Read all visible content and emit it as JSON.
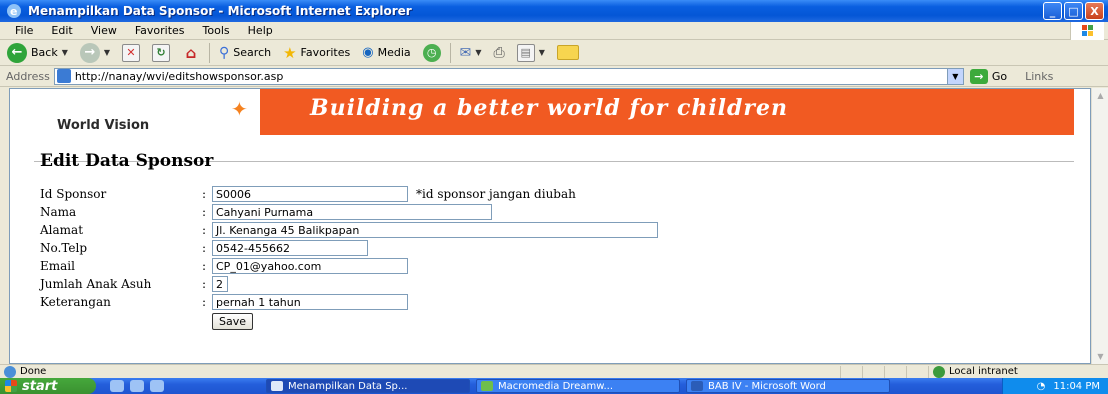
{
  "window": {
    "title": "Menampilkan Data Sponsor - Microsoft Internet Explorer",
    "buttons": [
      "_",
      "□",
      "X"
    ]
  },
  "menu": [
    "File",
    "Edit",
    "View",
    "Favorites",
    "Tools",
    "Help"
  ],
  "toolbar": {
    "back": "Back",
    "search": "Search",
    "favorites": "Favorites",
    "media": "Media"
  },
  "address": {
    "label": "Address",
    "url": "http://nanay/wvi/editshowsponsor.asp",
    "go": "Go",
    "links": "Links"
  },
  "banner": {
    "logo": "World Vision",
    "tagline": "Building a better world for children"
  },
  "page": {
    "heading": "Edit Data Sponsor",
    "fields": [
      {
        "label": "Id Sponsor",
        "value": "S0006",
        "note": "*id sponsor jangan diubah"
      },
      {
        "label": "Nama",
        "value": "Cahyani Purnama"
      },
      {
        "label": "Alamat",
        "value": "Jl. Kenanga 45 Balikpapan"
      },
      {
        "label": "No.Telp",
        "value": "0542-455662"
      },
      {
        "label": "Email",
        "value": "CP_01@yahoo.com"
      },
      {
        "label": "Jumlah Anak Asuh",
        "value": "2"
      },
      {
        "label": "Keterangan",
        "value": "pernah 1 tahun"
      }
    ],
    "colon": ":",
    "save": "Save"
  },
  "status": {
    "text": "Done",
    "zone": "Local intranet"
  },
  "taskbar": {
    "start": "start",
    "tasks": [
      "Menampilkan Data Sp...",
      "Macromedia Dreamw...",
      "BAB IV - Microsoft Word"
    ],
    "clock": "11:04 PM"
  },
  "colors": {
    "banner_orange": "#f15a22",
    "xp_blue": "#0456d6"
  }
}
